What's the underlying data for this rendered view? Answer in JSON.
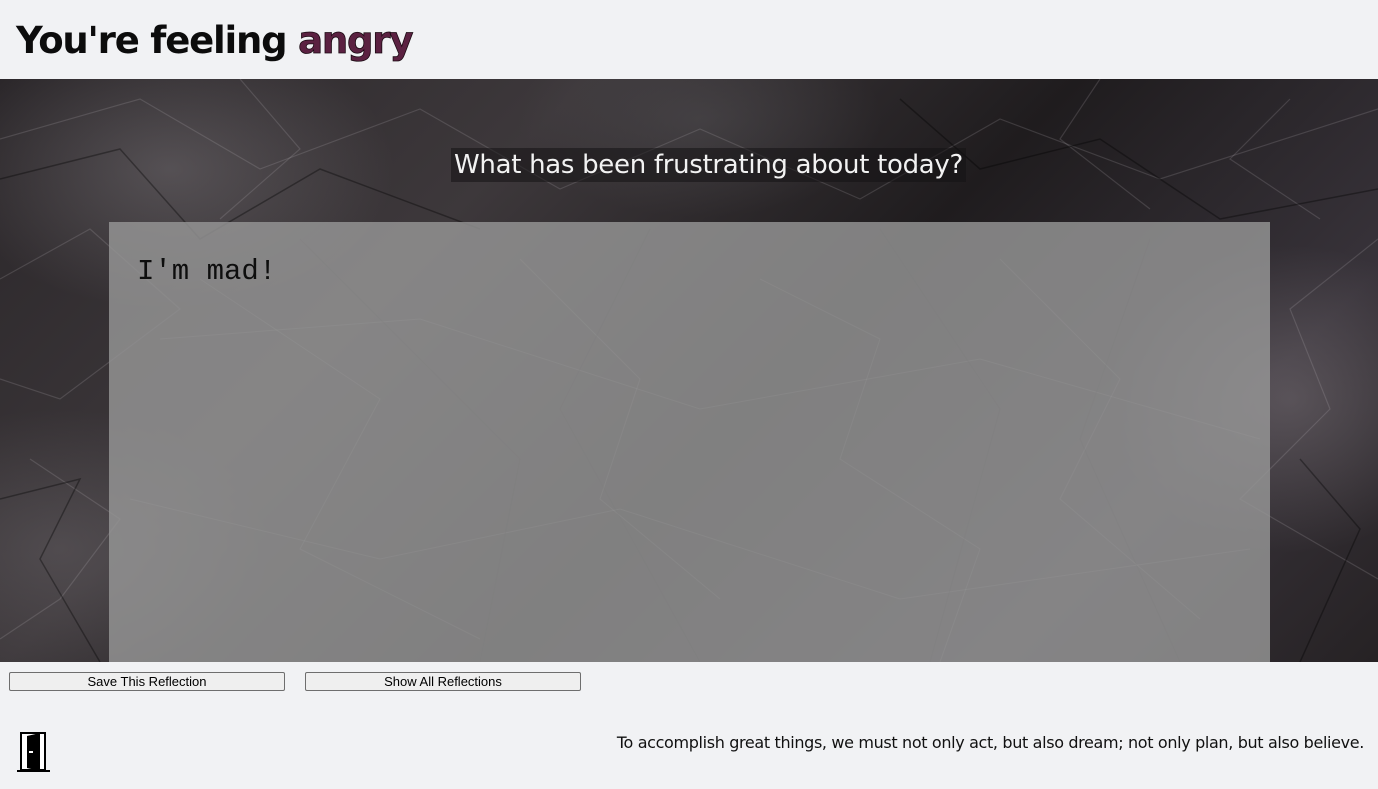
{
  "header": {
    "title_prefix": "You're feeling",
    "mood": "angry",
    "mood_color": "#5b2141"
  },
  "reflection": {
    "prompt": "What has been frustrating about today?",
    "entry_text": "I'm mad!",
    "background": "crumpled-paper-texture"
  },
  "actions": {
    "save_label": "Save This Reflection",
    "show_all_label": "Show All Reflections"
  },
  "footer": {
    "exit_icon": "door-icon",
    "quote": "To accomplish great things, we must not only act, but also dream; not only plan, but also believe."
  }
}
